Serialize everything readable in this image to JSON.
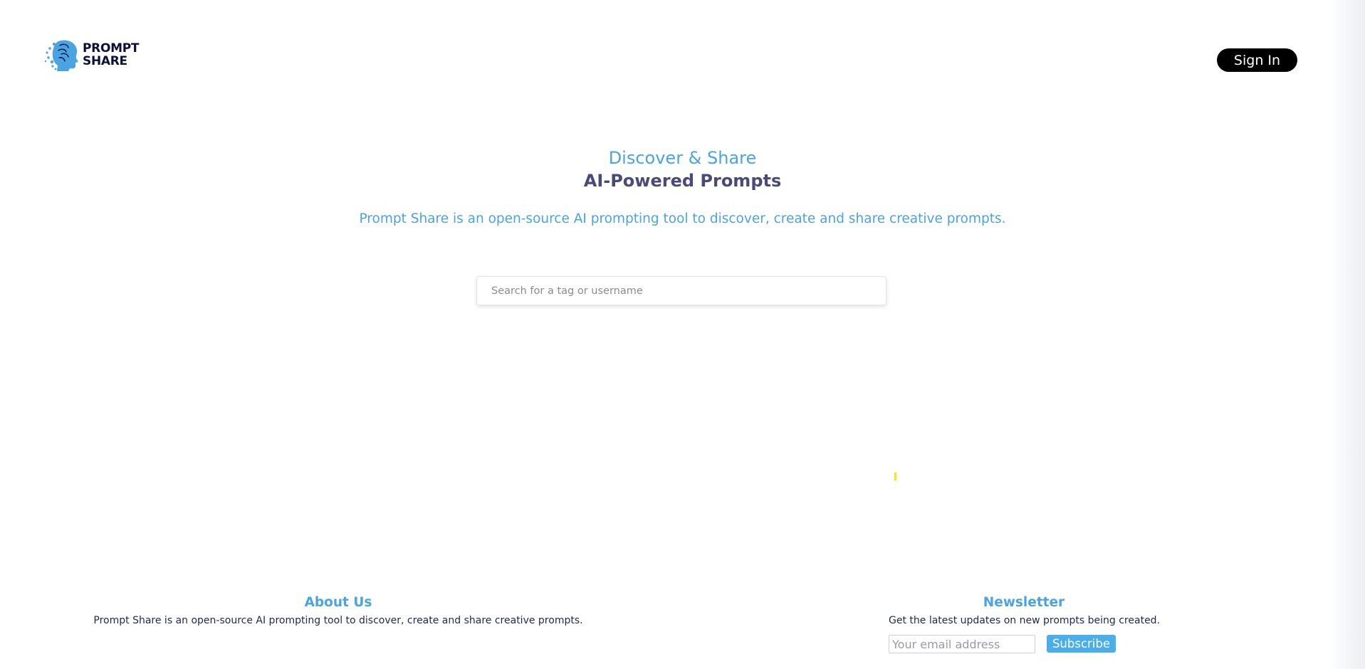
{
  "header": {
    "logo_line1": "PROMPT",
    "logo_line2": "SHARE",
    "logo_icon": "brain-head-icon",
    "signin_label": "Sign In"
  },
  "hero": {
    "title": "Discover & Share",
    "subtitle": "AI-Powered Prompts",
    "description": "Prompt Share is an open-source AI prompting tool to discover, create and share creative prompts."
  },
  "search": {
    "placeholder": "Search for a tag or username",
    "value": ""
  },
  "footer": {
    "about_title": "About Us",
    "about_text": "Prompt Share is an open-source AI prompting tool to discover, create and share creative prompts.",
    "newsletter_title": "Newsletter",
    "newsletter_text": "Get the latest updates on new prompts being created.",
    "email_placeholder": "Your email address",
    "subscribe_label": "Subscribe"
  },
  "colors": {
    "accent": "#4aa4e2",
    "heading_dark": "#4a4a7a",
    "text_dark": "#1e2850",
    "button_dark": "#000000",
    "subscribe_bg": "#4aaee8"
  }
}
